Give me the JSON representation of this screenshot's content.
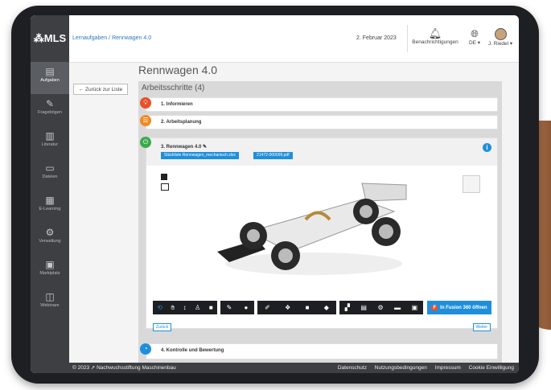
{
  "app": {
    "logo": "⁂MLS"
  },
  "breadcrumb": {
    "part1": "Lernaufgaben",
    "sep": " / ",
    "part2": "Rennwagen 4.0"
  },
  "header": {
    "date": "2. Februar 2023",
    "notifications_label": "Benachrichtigungen",
    "language": "DE ▾",
    "user": "J. Riedel ▾"
  },
  "sidebar": {
    "items": [
      {
        "label": "Aufgaben",
        "icon": "task-icon"
      },
      {
        "label": "Fragebögen",
        "icon": "questionnaire-icon"
      },
      {
        "label": "Literatur",
        "icon": "books-icon"
      },
      {
        "label": "Dateien",
        "icon": "folder-icon"
      },
      {
        "label": "E-Learning",
        "icon": "elearning-icon"
      },
      {
        "label": "Verwaltung",
        "icon": "admin-icon"
      },
      {
        "label": "Marktplatz",
        "icon": "market-icon"
      },
      {
        "label": "Webinare",
        "icon": "webinar-icon"
      }
    ]
  },
  "page": {
    "back_label": "← Zurück zur Liste",
    "title": "Rennwagen 4.0",
    "section_title": "Arbeitsschritte (4)"
  },
  "steps": [
    {
      "label": "1. Informieren",
      "color": "#e8512a",
      "icon": "lightbulb-icon"
    },
    {
      "label": "2. Arbeitsplanung",
      "color": "#f08a23",
      "icon": "list-icon"
    },
    {
      "label": "3. Rennwagen 4.0 ✎",
      "color": "#3bab4a",
      "icon": "power-icon"
    },
    {
      "label": "4. Kontrolle und Bewertung",
      "color": "#1f8fdc",
      "icon": "pie-icon"
    }
  ],
  "open_step": {
    "attachments": [
      "Stückliste Rennwagen_mechanisch.xlsx",
      "21472-000099.pdf"
    ],
    "fusion_button": "In Fusion 360 öffnen",
    "back_button": "Zurück",
    "next_button": "Weiter",
    "toolbar_icons": [
      "orbit-icon",
      "pan-icon",
      "zoom-icon",
      "fit-icon",
      "camera-icon",
      "pencil-icon",
      "eraser-icon",
      "markup-icon",
      "explode-icon",
      "folder-icon",
      "box-icon",
      "tree-icon",
      "properties-icon",
      "settings-icon",
      "print-icon",
      "fullscreen-icon"
    ]
  },
  "footer": {
    "copyright": "© 2023 ➚ Nachwuchsstiftung Maschinenbau",
    "links": [
      "Datenschutz",
      "Nutzungsbedingungen",
      "Impressum",
      "Cookie Einwilligung"
    ]
  },
  "colors": {
    "accent": "#1f8fdc",
    "sidebar": "#3d3f43"
  }
}
